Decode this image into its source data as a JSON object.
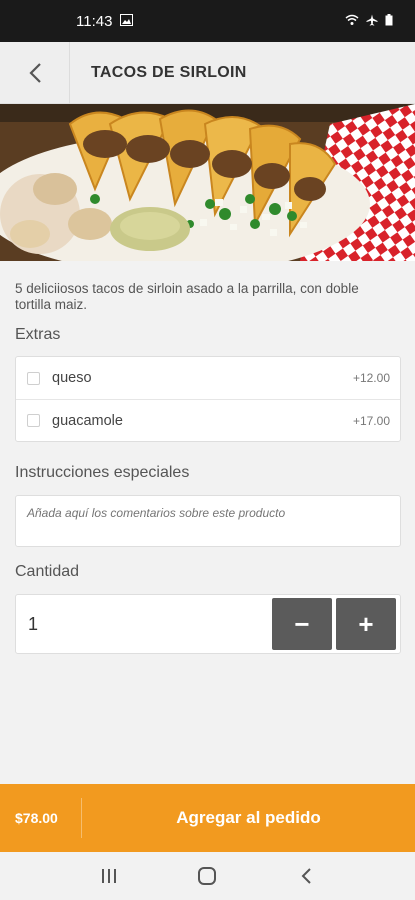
{
  "status_bar": {
    "time": "11:43"
  },
  "header": {
    "title": "TACOS DE SIRLOIN"
  },
  "product": {
    "description": "5 deliciiosos tacos de sirloin asado a la parrilla, con doble tortilla maiz."
  },
  "extras": {
    "label": "Extras",
    "items": [
      {
        "name": "queso",
        "price": "+12.00",
        "checked": false
      },
      {
        "name": "guacamole",
        "price": "+17.00",
        "checked": false
      }
    ]
  },
  "instructions": {
    "label": "Instrucciones especiales",
    "placeholder": "Añada aquí los comentarios sobre este producto"
  },
  "quantity": {
    "label": "Cantidad",
    "value": "1",
    "decrement_label": "−",
    "increment_label": "+"
  },
  "order_bar": {
    "total": "$78.00",
    "button_label": "Agregar al pedido"
  },
  "colors": {
    "accent": "#f29a1f",
    "stepper": "#5b5b5b"
  }
}
